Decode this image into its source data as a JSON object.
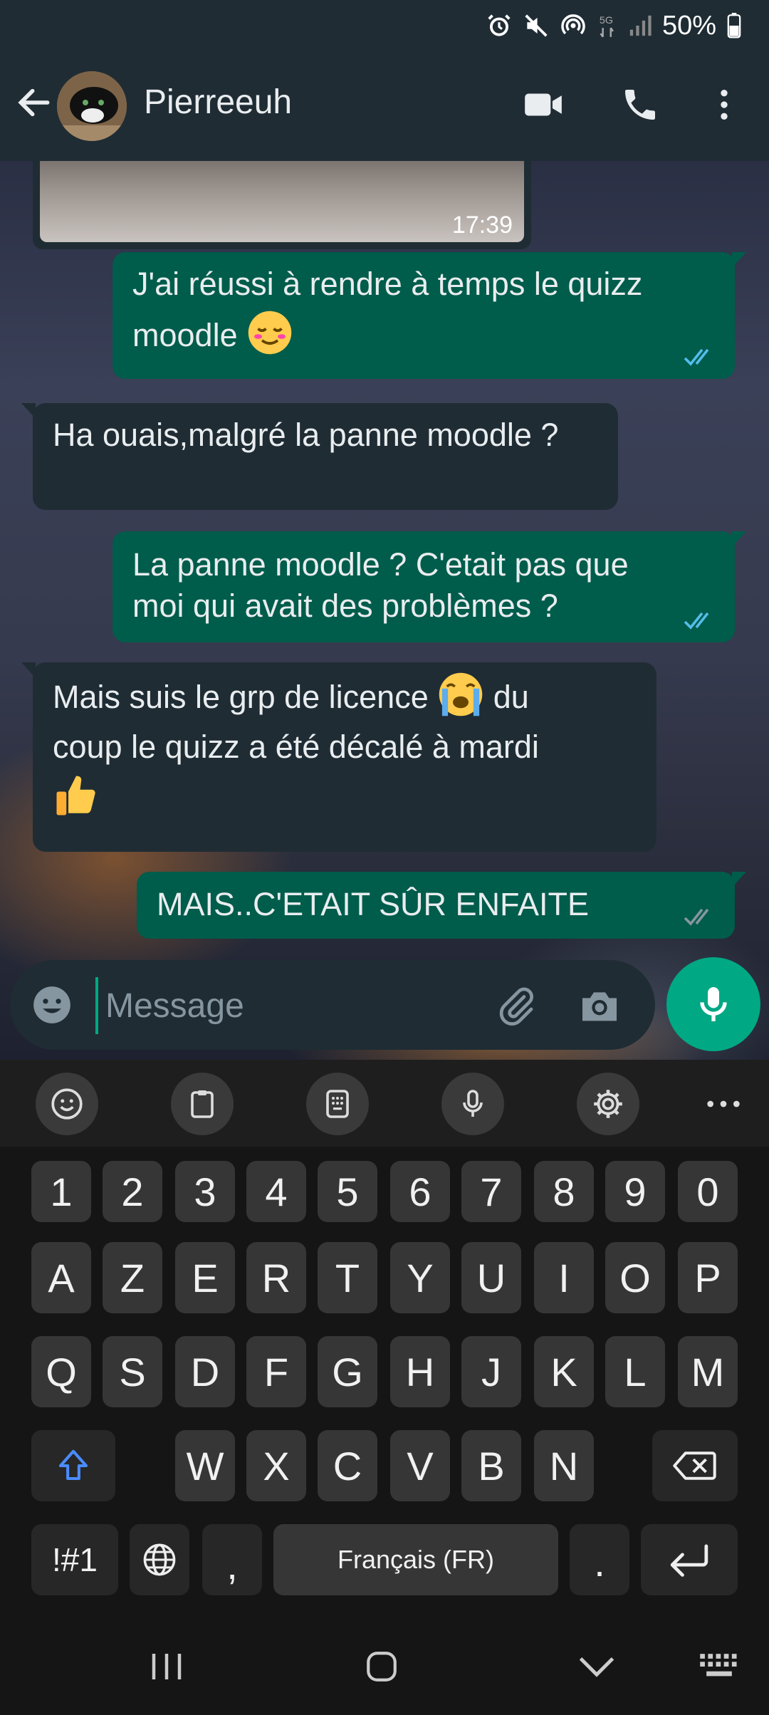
{
  "status_bar": {
    "battery": "50%"
  },
  "header": {
    "contact_name": "Pierreeuh"
  },
  "messages": [
    {
      "id": "photo",
      "direction": "incoming",
      "time": "17:39"
    },
    {
      "id": "m1",
      "direction": "outgoing",
      "lines": [
        "J'ai réussi à rendre à temps le quizz",
        "moodle"
      ],
      "emoji": "relieved-face",
      "status": "read"
    },
    {
      "id": "m2",
      "direction": "incoming",
      "lines": [
        "Ha ouais,malgré la panne moodle ?"
      ]
    },
    {
      "id": "m3",
      "direction": "outgoing",
      "lines": [
        "La panne moodle ? C'etait pas que",
        "moi qui avait des problèmes ?"
      ],
      "status": "read"
    },
    {
      "id": "m4",
      "direction": "incoming",
      "lines": [
        "Mais suis le grp de licence",
        "du",
        "coup le quizz a été décalé à mardi"
      ],
      "emoji": [
        "loudly-crying-face",
        "thumbs-up"
      ]
    },
    {
      "id": "m5",
      "direction": "outgoing",
      "lines": [
        "MAIS..C'ETAIT SÛR ENFAITE"
      ],
      "status": "delivered"
    }
  ],
  "composer": {
    "placeholder": "Message"
  },
  "keyboard": {
    "toolbar": [
      "emoji-icon",
      "clipboard-icon",
      "keypad-icon",
      "mic-icon",
      "settings-icon",
      "more-icon"
    ],
    "row_numbers": [
      "1",
      "2",
      "3",
      "4",
      "5",
      "6",
      "7",
      "8",
      "9",
      "0"
    ],
    "row1": [
      "A",
      "Z",
      "E",
      "R",
      "T",
      "Y",
      "U",
      "I",
      "O",
      "P"
    ],
    "row2": [
      "Q",
      "S",
      "D",
      "F",
      "G",
      "H",
      "J",
      "K",
      "L",
      "M"
    ],
    "row3": [
      "W",
      "X",
      "C",
      "V",
      "B",
      "N"
    ],
    "symbols_label": "!#1",
    "comma": ",",
    "space_label": "Français (FR)",
    "period": "."
  },
  "colors": {
    "accent": "#00a884",
    "outgoing_bubble": "#005c4b",
    "incoming_bubble": "#1f2c34",
    "read_ticks": "#53bdeb"
  }
}
